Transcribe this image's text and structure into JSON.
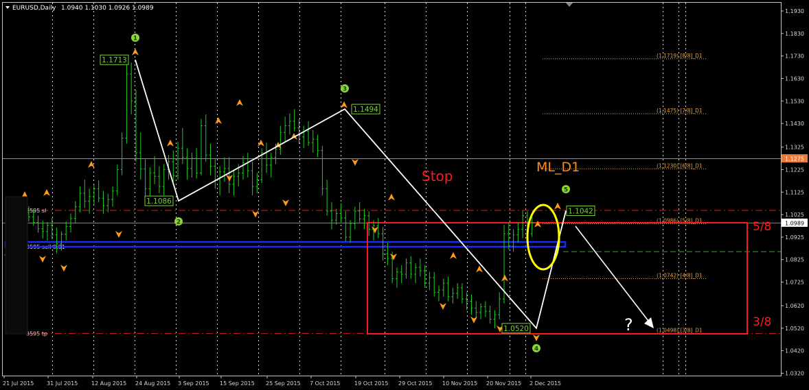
{
  "header": {
    "symbol_label": "EURUSD,Daily",
    "ohlc": "1.0940 1.1030 1.0926 1.0989"
  },
  "colors": {
    "background": "#000000",
    "candles": "#22cc22",
    "arrows": "#ff9a1a",
    "fib_levels": "#e8a33a",
    "wave_lines": "#ffffff",
    "stop_text": "#ff0000",
    "box": "#ff0000",
    "ellipse": "#ffff00",
    "blue_band": "#1a2bff",
    "badge": "#8dd63a",
    "price_tag_border": "#7ad13a",
    "hline": "#e0784a",
    "current_price_tag": "#ffffff"
  },
  "chart_data": {
    "type": "candlestick",
    "symbol": "EURUSD",
    "timeframe": "Daily",
    "ohlc_last": {
      "open": 1.094,
      "high": 1.103,
      "low": 1.0926,
      "close": 1.0989
    },
    "ylim": [
      1.028,
      1.196
    ],
    "y_ticks": [
      "1.1930",
      "1.1830",
      "1.1730",
      "1.1630",
      "1.1530",
      "1.1430",
      "1.1325",
      "1.1225",
      "1.1125",
      "1.1025",
      "1.0925",
      "1.0825",
      "1.0725",
      "1.0620",
      "1.0520",
      "1.0420",
      "1.0320"
    ],
    "y_tick_values": [
      1.193,
      1.183,
      1.173,
      1.163,
      1.153,
      1.143,
      1.1325,
      1.1225,
      1.1125,
      1.1025,
      1.0925,
      1.0825,
      1.0725,
      1.062,
      1.052,
      1.042,
      1.032
    ],
    "x_ticks": [
      "21 Jul 2015",
      "31 Jul 2015",
      "12 Aug 2015",
      "24 Aug 2015",
      "3 Sep 2015",
      "15 Sep 2015",
      "25 Sep 2015",
      "7 Oct 2015",
      "19 Oct 2015",
      "29 Oct 2015",
      "10 Nov 2015",
      "20 Nov 2015",
      "2 Dec 2015"
    ],
    "grid": true,
    "wave_points": [
      {
        "label": "1",
        "date": "2015-08-24",
        "price": 1.1713,
        "tag": "1.1713"
      },
      {
        "label": "2",
        "date": "2015-09-03",
        "price": 1.1086,
        "tag": "1.1086"
      },
      {
        "label": "3",
        "date": "2015-10-15",
        "price": 1.1494,
        "tag": "1.1494"
      },
      {
        "label": "4",
        "date": "2015-12-03",
        "price": 1.052,
        "tag": "1.0520"
      },
      {
        "label": "5",
        "date": "2015-12-07",
        "price": 1.1042,
        "tag": "1.1042"
      }
    ],
    "projection_target": {
      "price": 1.0498,
      "label": "?"
    },
    "murrey_levels": [
      {
        "price": 1.1719,
        "label": "(1.1719) [8/8]_D1"
      },
      {
        "price": 1.1475,
        "label": "(1.1475) [7/8]_D1"
      },
      {
        "price": 1.123,
        "label": "(1.1230) [6/8]_D1"
      },
      {
        "price": 1.0986,
        "label": "(1.0986) [5/8]_D1"
      },
      {
        "price": 1.0742,
        "label": "(1.0742) [4/8]_D1"
      },
      {
        "price": 1.0498,
        "label": "(1.0498) [3/8]_D1"
      }
    ],
    "horizontal_lines": [
      {
        "price": 1.1275,
        "label": "1.1275",
        "style": "solid"
      },
      {
        "price": 1.1045,
        "label": "3595 sl",
        "style": "dashdot"
      },
      {
        "price": 1.0883,
        "label": "3595 sell 0.01",
        "style": "band"
      },
      {
        "price": 1.0498,
        "label": "3595 tp",
        "style": "dashdot"
      }
    ],
    "current_price": "1.0989",
    "annotations": {
      "stop": "Stop",
      "ml": "ML_D1",
      "frac_high": "5/8",
      "frac_low": "3/8"
    },
    "candles": [
      [
        1.0845,
        1.0915,
        1.0815,
        1.0902
      ],
      [
        1.0902,
        1.0966,
        1.0884,
        1.094
      ],
      [
        1.094,
        1.0981,
        1.0912,
        1.0964
      ],
      [
        1.0964,
        1.102,
        1.0948,
        1.0992
      ],
      [
        1.0992,
        1.1045,
        1.0965,
        1.1028
      ],
      [
        1.1028,
        1.1062,
        1.0995,
        1.1015
      ],
      [
        1.1015,
        1.1048,
        1.0975,
        1.099
      ],
      [
        1.099,
        1.102,
        1.0945,
        1.0962
      ],
      [
        1.0962,
        1.0998,
        1.0918,
        1.095
      ],
      [
        1.095,
        1.0992,
        1.091,
        1.0978
      ],
      [
        1.0978,
        1.101,
        1.0915,
        1.0935
      ],
      [
        1.0935,
        1.0968,
        1.0852,
        1.0895
      ],
      [
        1.0895,
        1.095,
        1.0865,
        1.0938
      ],
      [
        1.0938,
        1.0995,
        1.091,
        1.0972
      ],
      [
        1.0972,
        1.103,
        1.0945,
        1.1008
      ],
      [
        1.1008,
        1.1085,
        1.0985,
        1.106
      ],
      [
        1.106,
        1.115,
        1.1035,
        1.112
      ],
      [
        1.112,
        1.118,
        1.1055,
        1.1085
      ],
      [
        1.1085,
        1.114,
        1.103,
        1.1105
      ],
      [
        1.1105,
        1.116,
        1.107,
        1.114
      ],
      [
        1.114,
        1.1178,
        1.108,
        1.1098
      ],
      [
        1.1098,
        1.113,
        1.103,
        1.1065
      ],
      [
        1.1065,
        1.1118,
        1.1035,
        1.1092
      ],
      [
        1.1092,
        1.115,
        1.106,
        1.113
      ],
      [
        1.113,
        1.1248,
        1.111,
        1.1225
      ],
      [
        1.1225,
        1.139,
        1.12,
        1.1365
      ],
      [
        1.1365,
        1.1725,
        1.134,
        1.165
      ],
      [
        1.165,
        1.17,
        1.147,
        1.153
      ],
      [
        1.153,
        1.158,
        1.126,
        1.13
      ],
      [
        1.13,
        1.139,
        1.118,
        1.1228
      ],
      [
        1.1228,
        1.127,
        1.108,
        1.114
      ],
      [
        1.114,
        1.1235,
        1.109,
        1.121
      ],
      [
        1.121,
        1.1285,
        1.116,
        1.1195
      ],
      [
        1.1195,
        1.124,
        1.112,
        1.115
      ],
      [
        1.115,
        1.125,
        1.111,
        1.1225
      ],
      [
        1.1225,
        1.129,
        1.118,
        1.126
      ],
      [
        1.126,
        1.131,
        1.117,
        1.1198
      ],
      [
        1.1198,
        1.135,
        1.118,
        1.132
      ],
      [
        1.132,
        1.141,
        1.125,
        1.128
      ],
      [
        1.128,
        1.132,
        1.118,
        1.123
      ],
      [
        1.123,
        1.13,
        1.119,
        1.1275
      ],
      [
        1.1275,
        1.132,
        1.1185,
        1.121
      ],
      [
        1.121,
        1.145,
        1.12,
        1.142
      ],
      [
        1.142,
        1.147,
        1.126,
        1.129
      ],
      [
        1.129,
        1.134,
        1.12,
        1.124
      ],
      [
        1.124,
        1.127,
        1.114,
        1.118
      ],
      [
        1.118,
        1.124,
        1.111,
        1.1215
      ],
      [
        1.1215,
        1.128,
        1.117,
        1.123
      ],
      [
        1.123,
        1.128,
        1.112,
        1.116
      ],
      [
        1.116,
        1.1225,
        1.111,
        1.1195
      ],
      [
        1.1195,
        1.125,
        1.115,
        1.121
      ],
      [
        1.121,
        1.1285,
        1.118,
        1.1255
      ],
      [
        1.1255,
        1.13,
        1.119,
        1.122
      ],
      [
        1.122,
        1.126,
        1.111,
        1.115
      ],
      [
        1.115,
        1.121,
        1.112,
        1.118
      ],
      [
        1.118,
        1.132,
        1.1165,
        1.13
      ],
      [
        1.13,
        1.1345,
        1.121,
        1.1245
      ],
      [
        1.1245,
        1.13,
        1.119,
        1.128
      ],
      [
        1.128,
        1.134,
        1.125,
        1.1315
      ],
      [
        1.1315,
        1.142,
        1.129,
        1.139
      ],
      [
        1.139,
        1.146,
        1.135,
        1.142
      ],
      [
        1.142,
        1.1475,
        1.138,
        1.144
      ],
      [
        1.144,
        1.1494,
        1.1395,
        1.141
      ],
      [
        1.141,
        1.145,
        1.134,
        1.137
      ],
      [
        1.137,
        1.142,
        1.132,
        1.1395
      ],
      [
        1.1395,
        1.144,
        1.133,
        1.1345
      ],
      [
        1.1345,
        1.14,
        1.13,
        1.136
      ],
      [
        1.136,
        1.138,
        1.128,
        1.131
      ],
      [
        1.131,
        1.133,
        1.111,
        1.114
      ],
      [
        1.114,
        1.118,
        1.102,
        1.104
      ],
      [
        1.104,
        1.108,
        1.096,
        1.1
      ],
      [
        1.1,
        1.105,
        1.098,
        1.103
      ],
      [
        1.103,
        1.1075,
        1.099,
        1.101
      ],
      [
        1.101,
        1.104,
        1.0905,
        1.0925
      ],
      [
        1.0925,
        1.1,
        1.09,
        1.0985
      ],
      [
        1.0985,
        1.106,
        1.096,
        1.104
      ],
      [
        1.104,
        1.108,
        1.099,
        1.1005
      ],
      [
        1.1005,
        1.105,
        1.096,
        1.102
      ],
      [
        1.102,
        1.104,
        1.093,
        1.096
      ],
      [
        1.096,
        1.1,
        1.091,
        1.0975
      ],
      [
        1.0975,
        1.101,
        1.092,
        1.094
      ],
      [
        1.094,
        1.097,
        1.082,
        1.085
      ],
      [
        1.085,
        1.09,
        1.08,
        1.083
      ],
      [
        1.083,
        1.086,
        1.072,
        1.074
      ],
      [
        1.074,
        1.079,
        1.07,
        1.077
      ],
      [
        1.077,
        1.08,
        1.072,
        1.076
      ],
      [
        1.076,
        1.083,
        1.074,
        1.081
      ],
      [
        1.081,
        1.084,
        1.074,
        1.076
      ],
      [
        1.076,
        1.081,
        1.072,
        1.079
      ],
      [
        1.079,
        1.083,
        1.075,
        1.0775
      ],
      [
        1.0775,
        1.08,
        1.07,
        1.072
      ],
      [
        1.072,
        1.077,
        1.069,
        1.0745
      ],
      [
        1.0745,
        1.077,
        1.066,
        1.068
      ],
      [
        1.068,
        1.071,
        1.064,
        1.069
      ],
      [
        1.069,
        1.074,
        1.066,
        1.072
      ],
      [
        1.072,
        1.075,
        1.064,
        1.066
      ],
      [
        1.066,
        1.07,
        1.063,
        1.0675
      ],
      [
        1.0675,
        1.072,
        1.065,
        1.07
      ],
      [
        1.07,
        1.072,
        1.063,
        1.065
      ],
      [
        1.065,
        1.068,
        1.06,
        1.064
      ],
      [
        1.064,
        1.067,
        1.058,
        1.061
      ],
      [
        1.061,
        1.064,
        1.056,
        1.059
      ],
      [
        1.059,
        1.063,
        1.056,
        1.0615
      ],
      [
        1.0615,
        1.064,
        1.057,
        1.0595
      ],
      [
        1.0595,
        1.062,
        1.054,
        1.056
      ],
      [
        1.056,
        1.06,
        1.052,
        1.058
      ],
      [
        1.058,
        1.068,
        1.056,
        1.065
      ],
      [
        1.065,
        1.098,
        1.063,
        1.094
      ],
      [
        1.094,
        1.099,
        1.087,
        1.0885
      ],
      [
        1.0885,
        1.096,
        1.086,
        1.0935
      ],
      [
        1.0935,
        1.099,
        1.09,
        1.096
      ],
      [
        1.096,
        1.1042,
        1.092,
        1.102
      ],
      [
        1.102,
        1.104,
        1.095,
        1.098
      ],
      [
        1.094,
        1.103,
        1.0926,
        1.0989
      ]
    ]
  }
}
